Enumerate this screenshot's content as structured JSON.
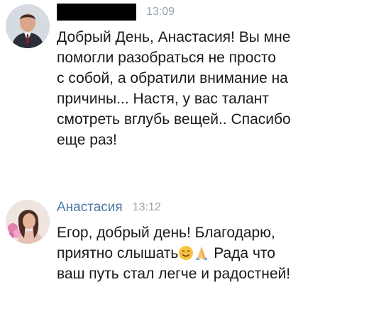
{
  "messages": [
    {
      "author_redacted": true,
      "time": "13:09",
      "lines": [
        "Добрый День, Анастасия! Вы мне",
        "помогли разобраться не просто",
        "с собой, а обратили внимание на",
        "причины... Настя, у вас талант",
        "смотреть вглубь вещей.. Спасибо",
        "еще раз!"
      ]
    },
    {
      "author": "Анастасия",
      "time": "13:12",
      "line1": "Егор, добрый день! Благодарю,",
      "line2_before_emoji": "приятно слышать",
      "line2_after_emoji": " Рада что",
      "line3": "ваш путь стал легче и радостней!",
      "emojis": [
        "smiling-face-icon",
        "folded-hands-icon"
      ]
    }
  ],
  "colors": {
    "author_name": "#4a76a8",
    "timestamp": "#9aa3ad",
    "text": "#1a1a1a",
    "background": "#ffffff"
  }
}
